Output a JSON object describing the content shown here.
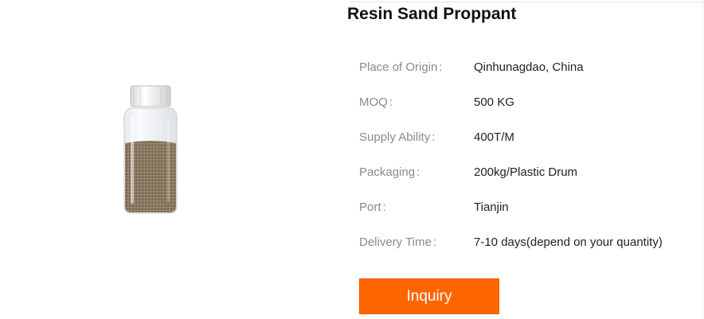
{
  "product": {
    "title": "Resin Sand Proppant",
    "image_description": "resin-sand-jar"
  },
  "specs": [
    {
      "label": "Place of Origin",
      "colon": ":",
      "value": "Qinhunagdao, China"
    },
    {
      "label": "MOQ",
      "colon": ":",
      "value": "500 KG"
    },
    {
      "label": "Supply Ability",
      "colon": ":",
      "value": "400T/M"
    },
    {
      "label": "Packaging",
      "colon": ":",
      "value": "200kg/Plastic Drum"
    },
    {
      "label": "Port",
      "colon": ":",
      "value": "Tianjin"
    },
    {
      "label": "Delivery Time",
      "colon": ":",
      "value": "7-10 days(depend on your quantity)"
    }
  ],
  "actions": {
    "inquiry_label": "Inquiry"
  },
  "colors": {
    "button": "#ff6600",
    "label": "#8a8a8a",
    "value": "#222222"
  }
}
